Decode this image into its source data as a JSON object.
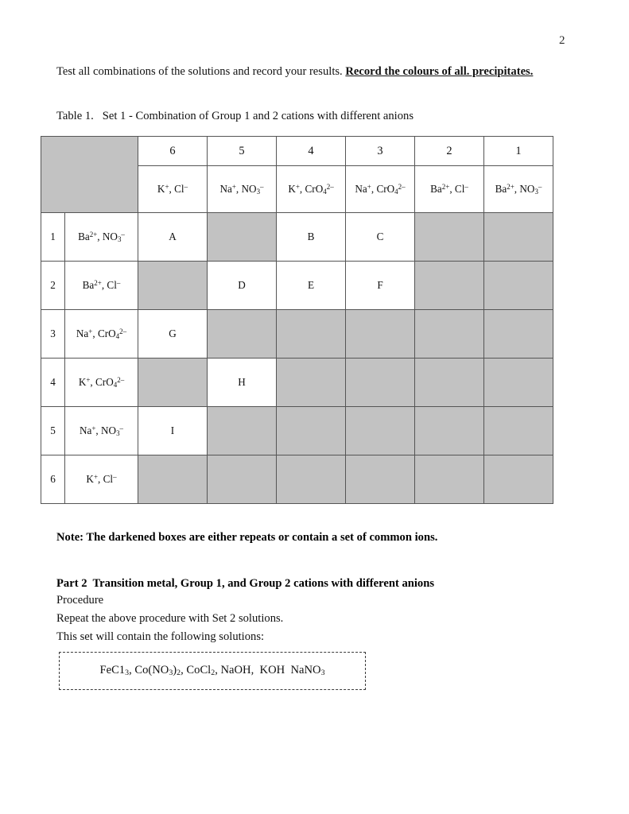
{
  "page": {
    "number": "2"
  },
  "intro": {
    "plain": "Test all combinations of the solutions and record your results. ",
    "emphasis": "Record the colours of all. precipitates."
  },
  "table_caption": "Table 1.   Set 1 - Combination of Group 1 and 2 cations with different anions",
  "table": {
    "column_numbers": [
      "6",
      "5",
      "4",
      "3",
      "2",
      "1"
    ],
    "column_ions_html": [
      "K<sup>+</sup>, Cl<sup>–</sup>",
      "Na<sup>+</sup>, NO<sub>3</sub><sup>–</sup>",
      "K<sup>+</sup>, CrO<sub>4</sub><sup>2–</sup>",
      "Na<sup>+</sup>, CrO<sub>4</sub><sup>2–</sup>",
      "Ba<sup>2+</sup>, Cl<sup>–</sup>",
      "Ba<sup>2+</sup>, NO<sub>3</sub><sup>–</sup>"
    ],
    "row_numbers": [
      "1",
      "2",
      "3",
      "4",
      "5",
      "6"
    ],
    "row_ions_html": [
      "Ba<sup>2+</sup>, NO<sub>3</sub><sup>–</sup>",
      "Ba<sup>2+</sup>, Cl<sup>–</sup>",
      "Na<sup>+</sup>, CrO<sub>4</sub><sup>2–</sup>",
      "K<sup>+</sup>, CrO<sub>4</sub><sup>2–</sup>",
      "Na<sup>+</sup>, NO<sub>3</sub><sup>–</sup>",
      "K<sup>+</sup>, Cl<sup>–</sup>"
    ],
    "cells": [
      [
        "A",
        "",
        "B",
        "C",
        "",
        ""
      ],
      [
        "",
        "D",
        "E",
        "F",
        "",
        ""
      ],
      [
        "G",
        "",
        "",
        "",
        "",
        ""
      ],
      [
        "",
        "H",
        "",
        "",
        "",
        ""
      ],
      [
        "I",
        "",
        "",
        "",
        "",
        ""
      ],
      [
        "",
        "",
        "",
        "",
        "",
        ""
      ]
    ],
    "shaded": [
      [
        false,
        true,
        false,
        false,
        true,
        true
      ],
      [
        true,
        false,
        false,
        false,
        true,
        true
      ],
      [
        false,
        true,
        true,
        true,
        true,
        true
      ],
      [
        true,
        false,
        true,
        true,
        true,
        true
      ],
      [
        false,
        true,
        true,
        true,
        true,
        true
      ],
      [
        true,
        true,
        true,
        true,
        true,
        true
      ]
    ],
    "shade_color": "#c2c2c2",
    "border_color": "#555555"
  },
  "note": "Note: The darkened boxes are either repeats or contain a set of common ions.",
  "part2": {
    "heading": "Part 2  Transition metal, Group 1, and Group 2 cations with different anions",
    "procedure_label": "Procedure",
    "repeat_line": "Repeat the above procedure with Set 2 solutions.",
    "contains_line": "This set will contain the following solutions:",
    "solutions_html": "FeC1<sub>3</sub>, Co(NO<sub>3</sub>)<sub>2</sub>, CoCl<sub>2</sub>, NaOH,  KOH  NaNO<sub>3</sub>"
  }
}
